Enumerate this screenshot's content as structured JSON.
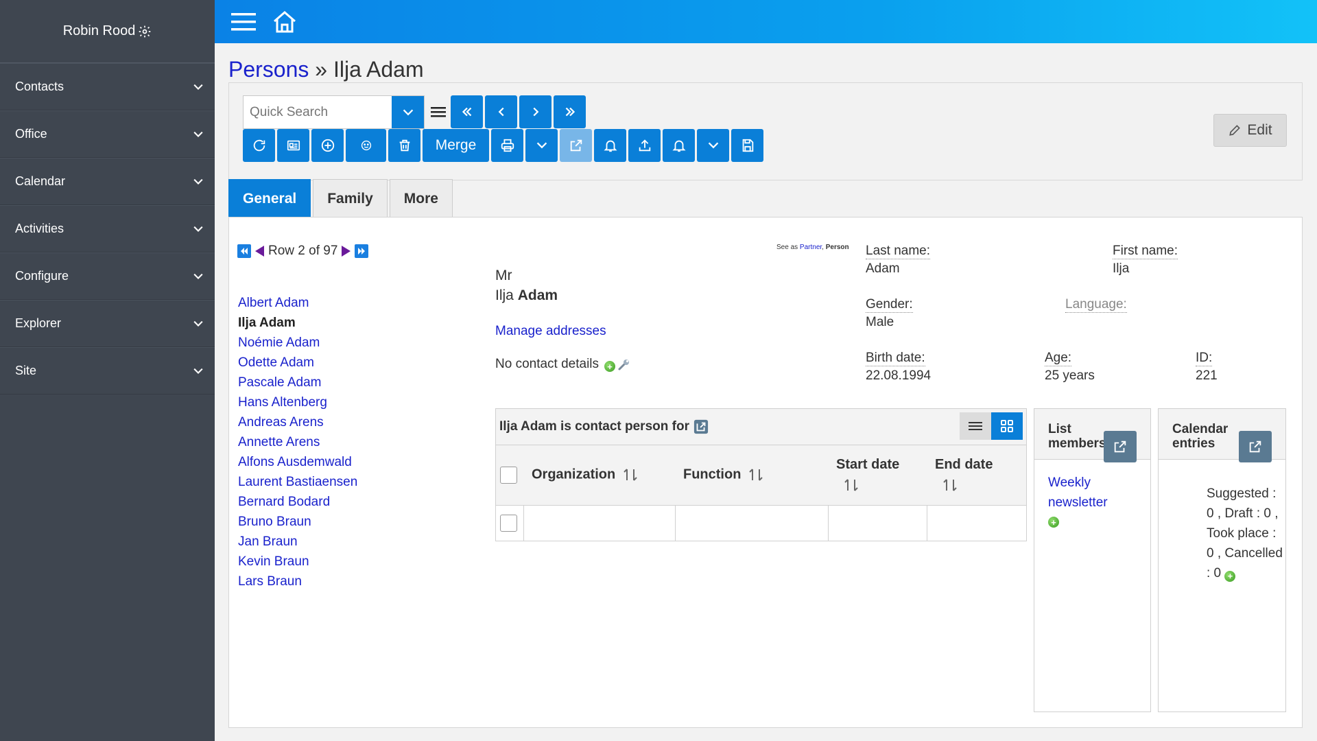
{
  "sidebar": {
    "user": "Robin Rood",
    "items": [
      {
        "label": "Contacts"
      },
      {
        "label": "Office"
      },
      {
        "label": "Calendar"
      },
      {
        "label": "Activities"
      },
      {
        "label": "Configure"
      },
      {
        "label": "Explorer"
      },
      {
        "label": "Site"
      }
    ]
  },
  "header": {
    "breadcrumb_link": "Persons",
    "separator": " » ",
    "title": "Ilja Adam"
  },
  "toolbar": {
    "search_placeholder": "Quick Search",
    "merge_label": "Merge",
    "edit_label": "Edit"
  },
  "tabs": [
    {
      "label": "General",
      "active": true
    },
    {
      "label": "Family",
      "active": false
    },
    {
      "label": "More",
      "active": false
    }
  ],
  "rownav": {
    "text": "Row 2 of 97"
  },
  "persons": [
    "Albert Adam",
    "Ilja Adam",
    "Noémie Adam",
    "Odette Adam",
    "Pascale Adam",
    "Hans Altenberg",
    "Andreas Arens",
    "Annette Arens",
    "Alfons Ausdemwald",
    "Laurent Bastiaensen",
    "Bernard Bodard",
    "Bruno Braun",
    "Jan Braun",
    "Kevin Braun",
    "Lars Braun"
  ],
  "see_as": {
    "prefix": "See as ",
    "partner": "Partner",
    "sep": ", ",
    "person": "Person"
  },
  "detail": {
    "salutation": "Mr",
    "first": "Ilja",
    "last": "Adam",
    "manage_addresses": "Manage addresses",
    "no_contact": "No contact details"
  },
  "fields": {
    "last_name_label": "Last name:",
    "last_name": "Adam",
    "first_name_label": "First name:",
    "first_name": "Ilja",
    "gender_label": "Gender:",
    "gender": "Male",
    "language_label": "Language:",
    "birth_label": "Birth date:",
    "birth": "22.08.1994",
    "age_label": "Age:",
    "age": "25 years",
    "id_label": "ID:",
    "id": "221"
  },
  "contact_person": {
    "title": "Ilja Adam is contact person for",
    "columns": [
      "Organization",
      "Function",
      "Start date",
      "End date"
    ]
  },
  "list_members": {
    "title_line1": "List",
    "title_line2": "members",
    "link": "Weekly newsletter"
  },
  "calendar": {
    "title_line1": "Calendar",
    "title_line2": "entries",
    "summary": "Suggested : 0 , Draft : 0 , Took place : 0 , Cancelled : 0"
  },
  "colors": {
    "accent": "#0a7fd8",
    "link": "#1a22cc",
    "sidebar": "#3f4650"
  }
}
